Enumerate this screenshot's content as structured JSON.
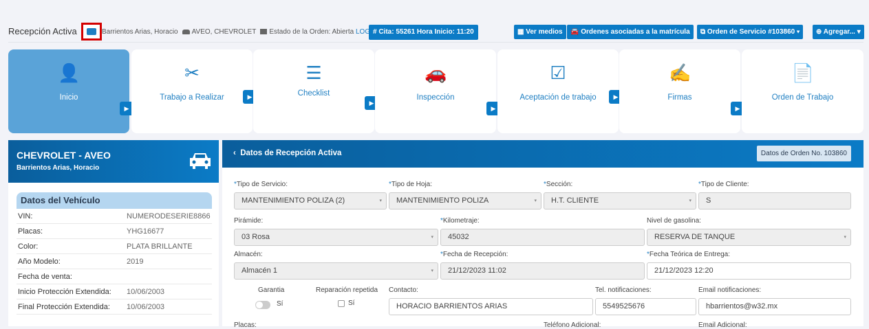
{
  "header": {
    "title": "Recepción Activa",
    "customer": "Barrientos Arias, Horacio",
    "vehicle": "AVEO, CHEVROLET",
    "order_state": "Estado de la Orden: Abierta",
    "log": "LOG",
    "cita": "# Cita: 55261 Hora Inicio: 11:20"
  },
  "toolbar": {
    "ver_medios": "Ver medios",
    "ordenes": "Ordenes asociadas a la matrícula",
    "orden": "Orden de Servicio #103860",
    "agregar": "Agregar..."
  },
  "steps": [
    {
      "label": "Inicio"
    },
    {
      "label": "Trabajo a Realizar"
    },
    {
      "label": "Checklist"
    },
    {
      "label": "Inspección"
    },
    {
      "label": "Aceptación de trabajo"
    },
    {
      "label": "Firmas"
    },
    {
      "label": "Orden de Trabajo"
    }
  ],
  "vehicle": {
    "make_model": "CHEVROLET - AVEO",
    "owner": "Barrientos Arias, Horacio",
    "box_title": "Datos del Vehículo",
    "rows": [
      {
        "k": "VIN:",
        "v": "NUMERODESERIE8866"
      },
      {
        "k": "Placas:",
        "v": "YHG16677"
      },
      {
        "k": "Color:",
        "v": "PLATA BRILLANTE"
      },
      {
        "k": "Año Modelo:",
        "v": "2019"
      },
      {
        "k": "Fecha de venta:",
        "v": ""
      },
      {
        "k": "Inicio Protección Extendida:",
        "v": "10/06/2003"
      },
      {
        "k": "Final Protección Extendida:",
        "v": "10/06/2003"
      }
    ]
  },
  "form": {
    "title": "Datos de Recepción Activa",
    "badge": "Datos de Orden No. 103860",
    "tipo_servicio_l": "Tipo de Servicio:",
    "tipo_servicio": "MANTENIMIENTO POLIZA (2)",
    "tipo_hoja_l": "Tipo de Hoja:",
    "tipo_hoja": "MANTENIMIENTO POLIZA",
    "seccion_l": "Sección:",
    "seccion": "H.T. CLIENTE",
    "tipo_cliente_l": "Tipo de Cliente:",
    "tipo_cliente": "S",
    "piramide_l": "Pirámide:",
    "piramide": "03 Rosa",
    "km_l": "Kilometraje:",
    "km": "45032",
    "gas_l": "Nivel de gasolina:",
    "gas": "RESERVA DE TANQUE",
    "almacen_l": "Almacén:",
    "almacen": "Almacén 1",
    "frec_l": "Fecha de Recepción:",
    "frec": "21/12/2023 11:02",
    "fent_l": "Fecha Teórica de Entrega:",
    "fent": "21/12/2023 12:20",
    "garantia_l": "Garantia",
    "si1": "Sí",
    "rep_l": "Reparación repetida",
    "si2": "Sí",
    "contacto_l": "Contacto:",
    "contacto": "HORACIO BARRIENTOS ARIAS",
    "tel_l": "Tel. notificaciones:",
    "tel": "5549525676",
    "email_l": "Email notificaciones:",
    "email": "hbarrientos@w32.mx",
    "placas_l": "Placas:",
    "tel_ad_l": "Teléfono Adicional:",
    "email_ad_l": "Email Adicional:"
  }
}
